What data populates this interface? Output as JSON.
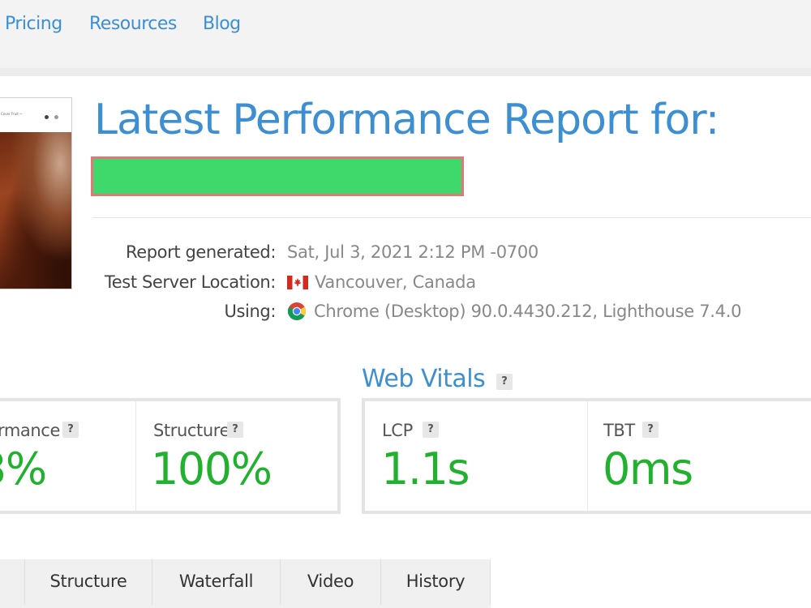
{
  "nav": {
    "items": [
      {
        "label": "Pricing"
      },
      {
        "label": "Resources"
      },
      {
        "label": "Blog"
      }
    ]
  },
  "thumbnail": {
    "nav_text": "Cover Fruit ~"
  },
  "report": {
    "title": "Latest Performance Report for:",
    "meta": [
      {
        "label": "Report generated:",
        "value": "Sat, Jul 3, 2021 2:12 PM -0700"
      },
      {
        "label": "Test Server Location:",
        "value": "Vancouver, Canada",
        "icon": "canada-flag-icon"
      },
      {
        "label": "Using:",
        "value": "Chrome (Desktop) 90.0.4430.212, Lighthouse 7.4.0",
        "icon": "chrome-icon"
      }
    ]
  },
  "grades": {
    "items": [
      {
        "label": "rmance",
        "help": "?",
        "value": "3%"
      },
      {
        "label": "Structure",
        "help": "?",
        "value": "100%"
      }
    ]
  },
  "web_vitals": {
    "heading": "Web Vitals",
    "help": "?",
    "items": [
      {
        "label": "LCP",
        "help": "?",
        "value": "1.1s"
      },
      {
        "label": "TBT",
        "help": "?",
        "value": "0ms"
      }
    ]
  },
  "tabs": [
    {
      "label": "Structure"
    },
    {
      "label": "Waterfall"
    },
    {
      "label": "Video"
    },
    {
      "label": "History"
    }
  ],
  "colors": {
    "accent": "#3d8fd1",
    "good": "#22b12f",
    "redaction_fill": "#3fd86a",
    "redaction_border": "#e07a7a"
  }
}
